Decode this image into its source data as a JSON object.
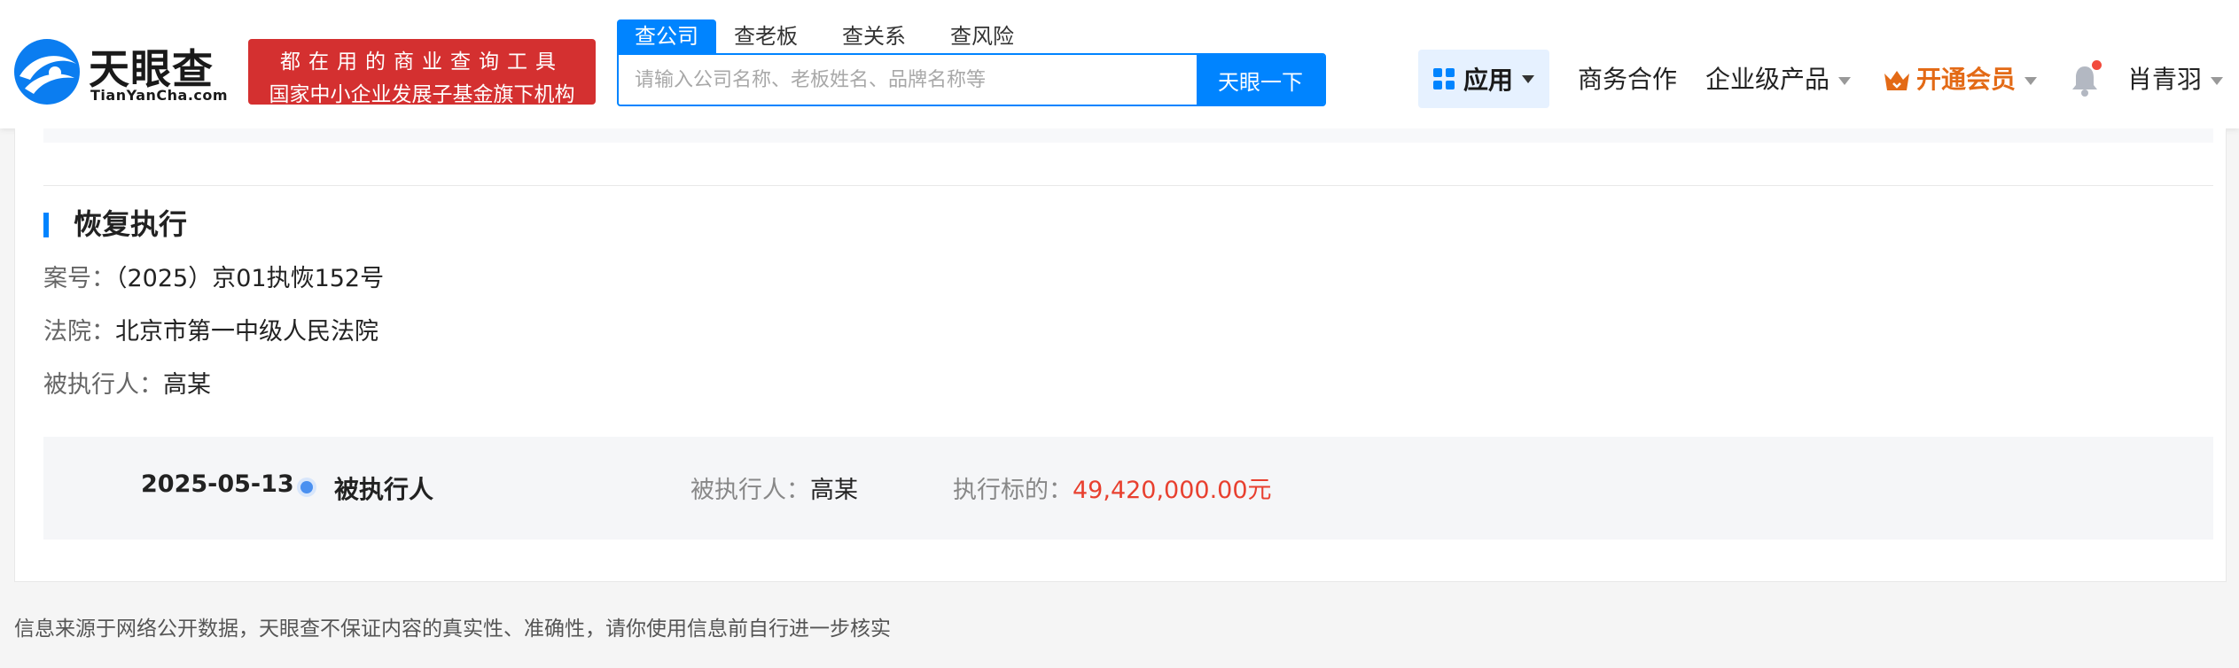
{
  "header": {
    "logo_cn": "天眼查",
    "logo_en": "TianYanCha.com",
    "slogan_line1": "都在用的商业查询工具",
    "slogan_line2": "国家中小企业发展子基金旗下机构",
    "search": {
      "tabs": [
        "查公司",
        "查老板",
        "查关系",
        "查风险"
      ],
      "active_tab": "查公司",
      "placeholder": "请输入公司名称、老板姓名、品牌名称等",
      "value": "",
      "button_label": "天眼一下"
    },
    "nav": {
      "apps_label": "应用",
      "business": "商务合作",
      "enterprise": "企业级产品",
      "vip": "开通会员",
      "user": "肖青羽"
    },
    "colors": {
      "brand_blue": "#0084ff",
      "slogan_red": "#d43030",
      "vip_orange": "#e36a16"
    }
  },
  "section": {
    "title": "恢复执行",
    "case_no_label": "案号：",
    "case_no": "（2025）京01执恢152号",
    "court_label": "法院：",
    "court": "北京市第一中级人民法院",
    "executee_label": "被执行人：",
    "executee": "高某"
  },
  "timeline": {
    "date": "2025-05-13",
    "role": "被执行人",
    "person_label": "被执行人：",
    "person": "高某",
    "amount_label": "执行标的：",
    "amount": "49,420,000.00元",
    "amount_color": "#e8402f"
  },
  "footer": {
    "note": "信息来源于网络公开数据，天眼查不保证内容的真实性、准确性，请你使用信息前自行进一步核实"
  }
}
